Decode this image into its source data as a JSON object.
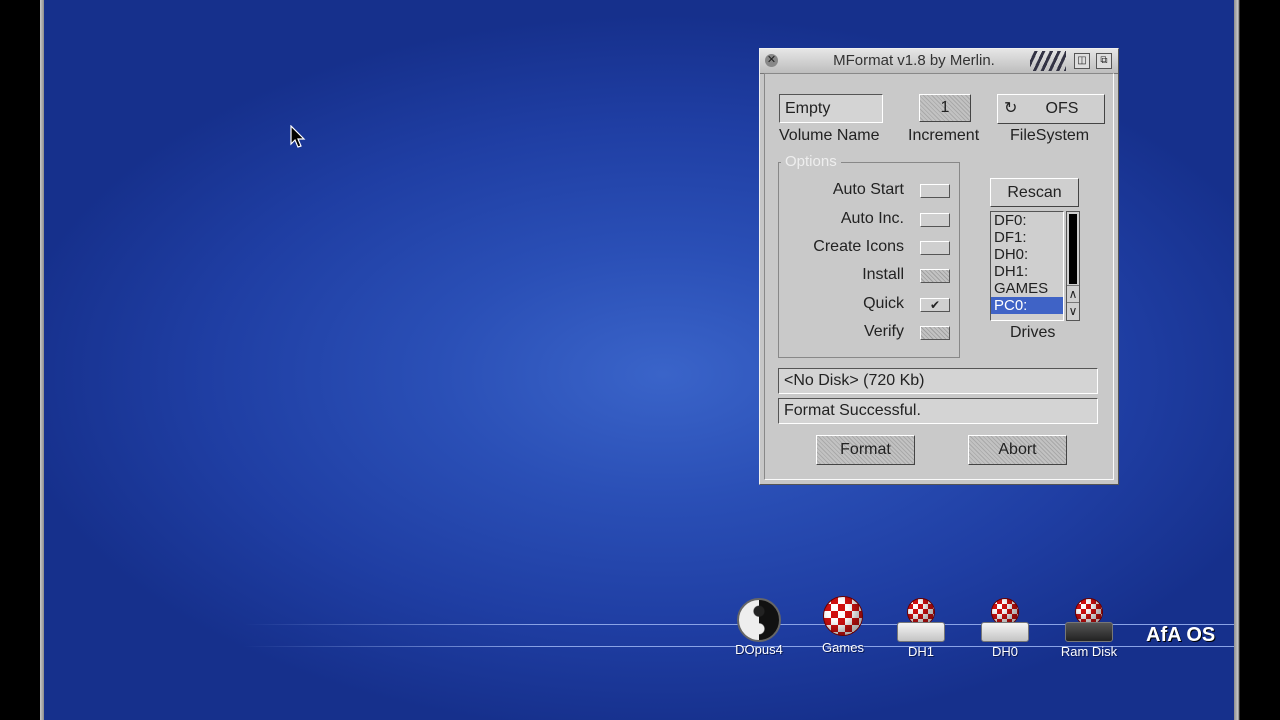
{
  "window": {
    "title": "MFormat v1.8 by Merlin.",
    "volume_name": {
      "value": "Empty",
      "label": "Volume Name"
    },
    "increment": {
      "value": "1",
      "label": "Increment"
    },
    "filesystem": {
      "value": "OFS",
      "label": "FileSystem"
    },
    "options": {
      "title": "Options",
      "items": [
        {
          "label": "Auto Start",
          "checked": false
        },
        {
          "label": "Auto Inc.",
          "checked": false
        },
        {
          "label": "Create Icons",
          "checked": false
        },
        {
          "label": "Install",
          "checked": false,
          "disabled": true
        },
        {
          "label": "Quick",
          "checked": true
        },
        {
          "label": "Verify",
          "checked": false,
          "disabled": true
        }
      ]
    },
    "rescan_label": "Rescan",
    "drives": {
      "label": "Drives",
      "items": [
        "DF0:",
        "DF1:",
        "DH0:",
        "DH1:",
        "GAMES",
        "PC0:"
      ],
      "selected": "PC0:"
    },
    "disk_info": "<No Disk>  (720 Kb)",
    "status": "Format Successful.",
    "format_label": "Format",
    "abort_label": "Abort"
  },
  "desktop": {
    "icons": [
      {
        "label": "DOpus4",
        "icon": "yin-yang-icon"
      },
      {
        "label": "Games",
        "icon": "boing-ball-icon"
      },
      {
        "label": "DH1",
        "icon": "harddisk-icon"
      },
      {
        "label": "DH0",
        "icon": "harddisk-icon"
      },
      {
        "label": "Ram Disk",
        "icon": "ramdisk-icon"
      }
    ],
    "brand": "AfA OS"
  }
}
